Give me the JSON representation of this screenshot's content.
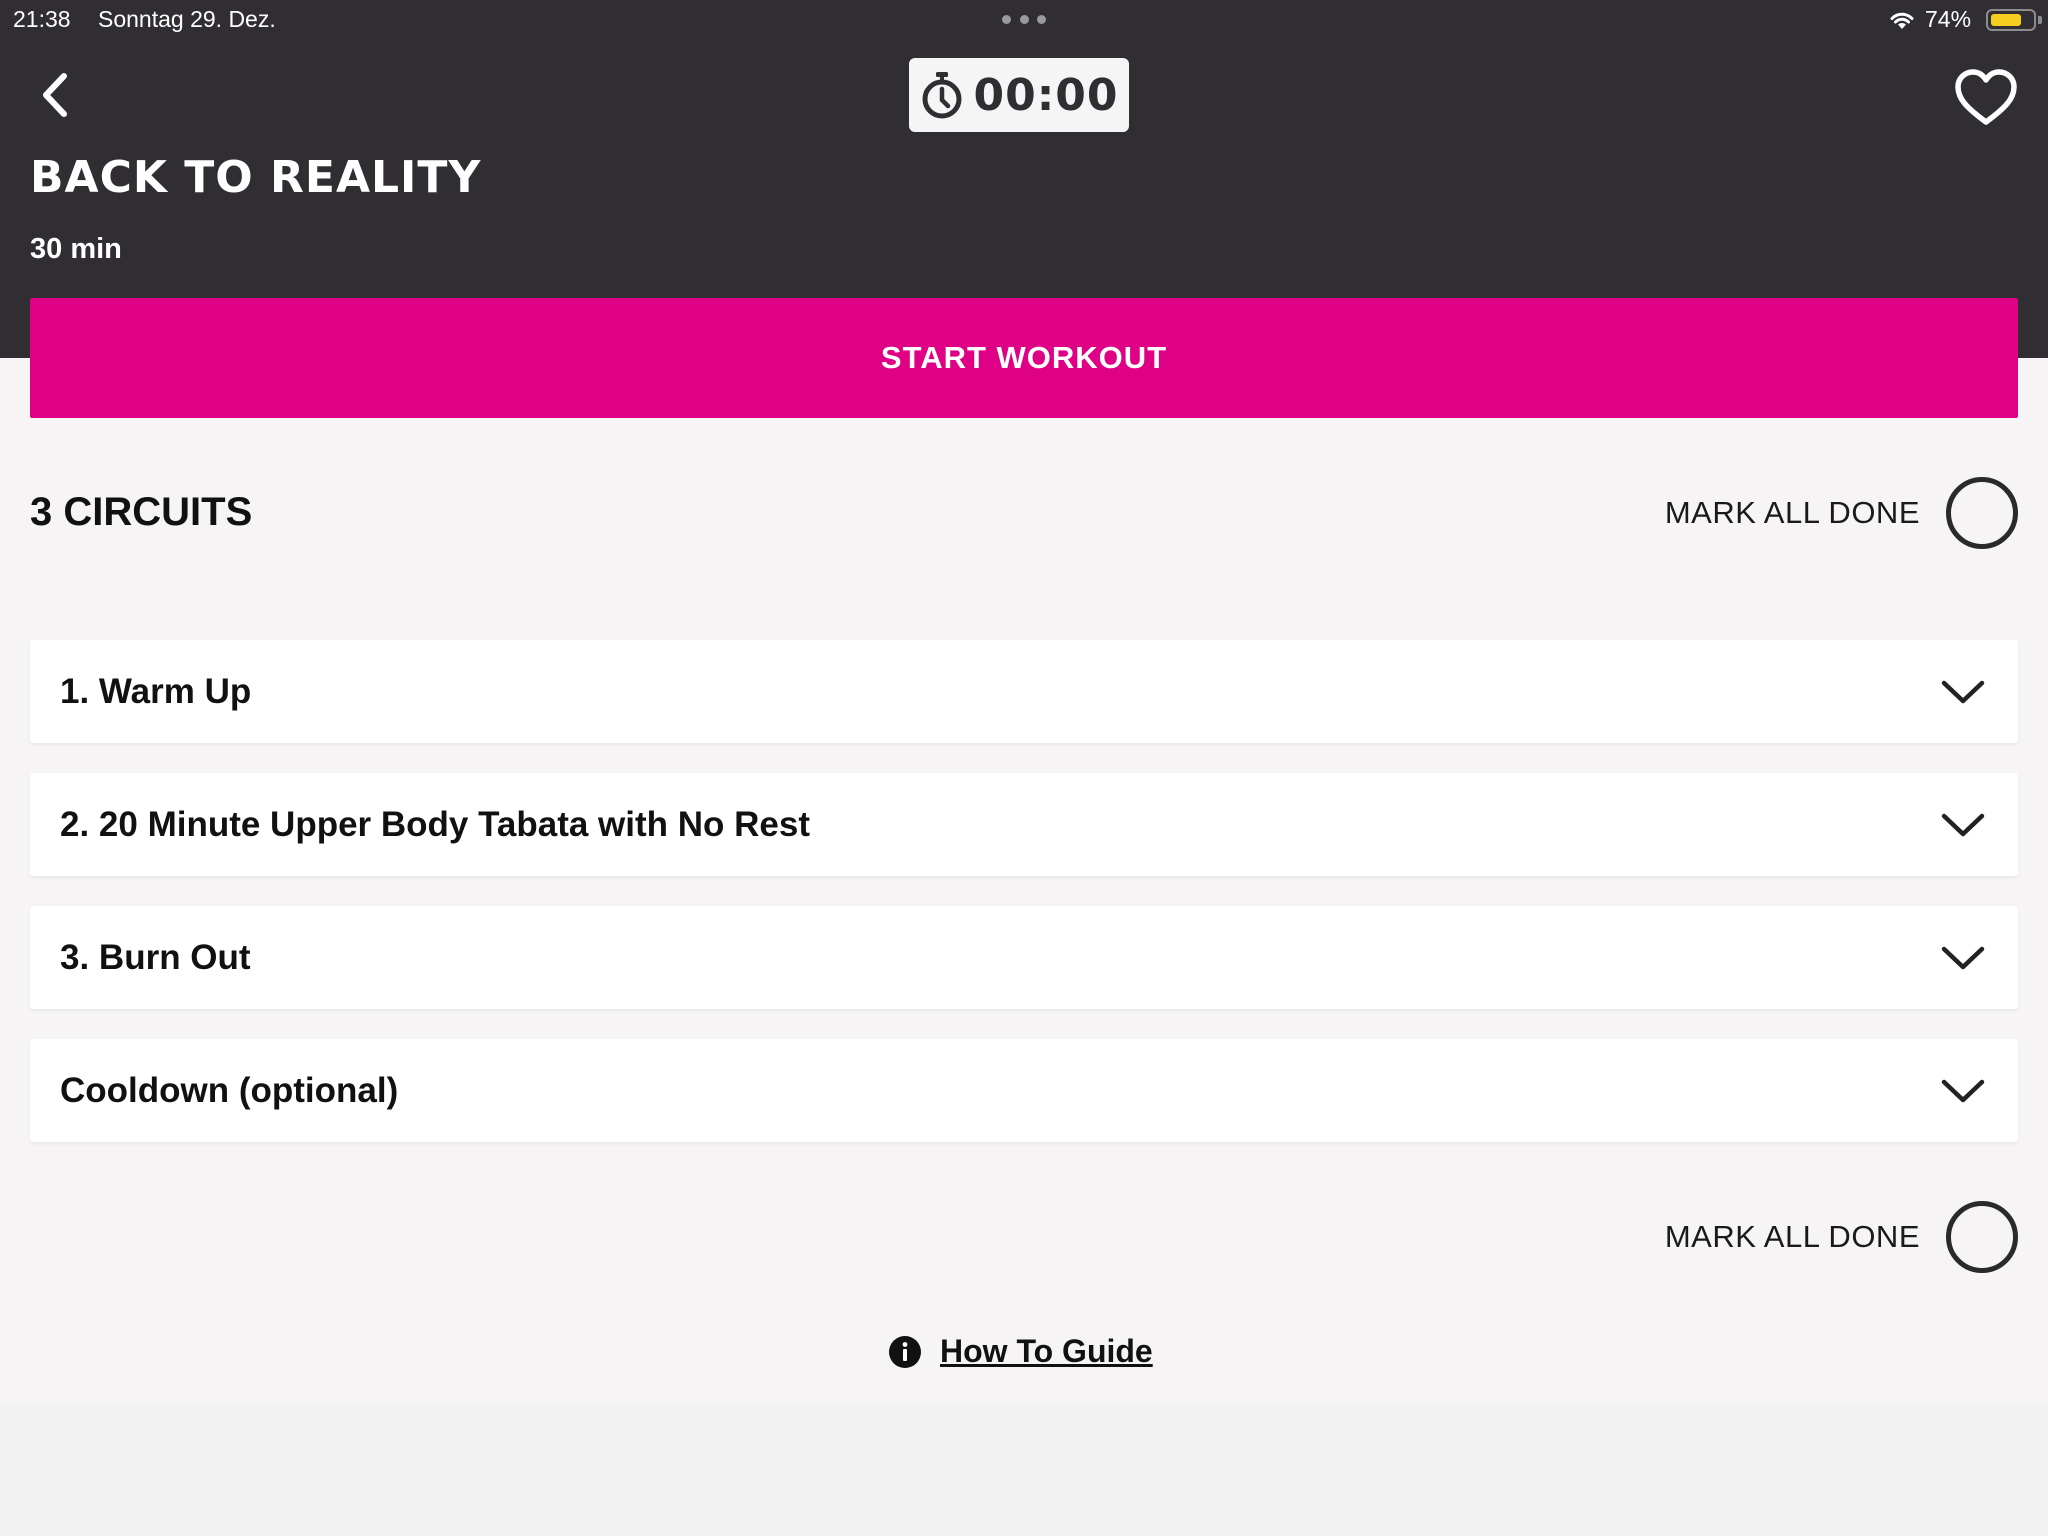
{
  "status_bar": {
    "time": "21:38",
    "date": "Sonntag 29. Dez.",
    "battery_percent": "74%",
    "battery_level": 0.74,
    "battery_color": "#f5cf1f"
  },
  "header": {
    "back_icon": "chevron-left-icon",
    "timer_icon": "stopwatch-icon",
    "timer_value": "00:00",
    "favorite_icon": "heart-outline-icon",
    "title": "BACK TO REALITY",
    "duration": "30 min",
    "background_color": "#312e33"
  },
  "start_button": {
    "label": "START WORKOUT",
    "color": "#df0085"
  },
  "circuits_section": {
    "title": "3 CIRCUITS",
    "mark_all_done_label": "MARK ALL DONE",
    "items": [
      {
        "name": "1. Warm Up",
        "icon": "chevron-down-icon"
      },
      {
        "name": "2. 20 Minute Upper Body Tabata with No Rest",
        "icon": "chevron-down-icon"
      },
      {
        "name": "3. Burn Out",
        "icon": "chevron-down-icon"
      },
      {
        "name": "Cooldown (optional)",
        "icon": "chevron-down-icon"
      }
    ],
    "mark_all_done_bottom_label": "MARK ALL DONE"
  },
  "footer": {
    "guide_icon": "info-icon",
    "guide_label": "How To Guide"
  }
}
